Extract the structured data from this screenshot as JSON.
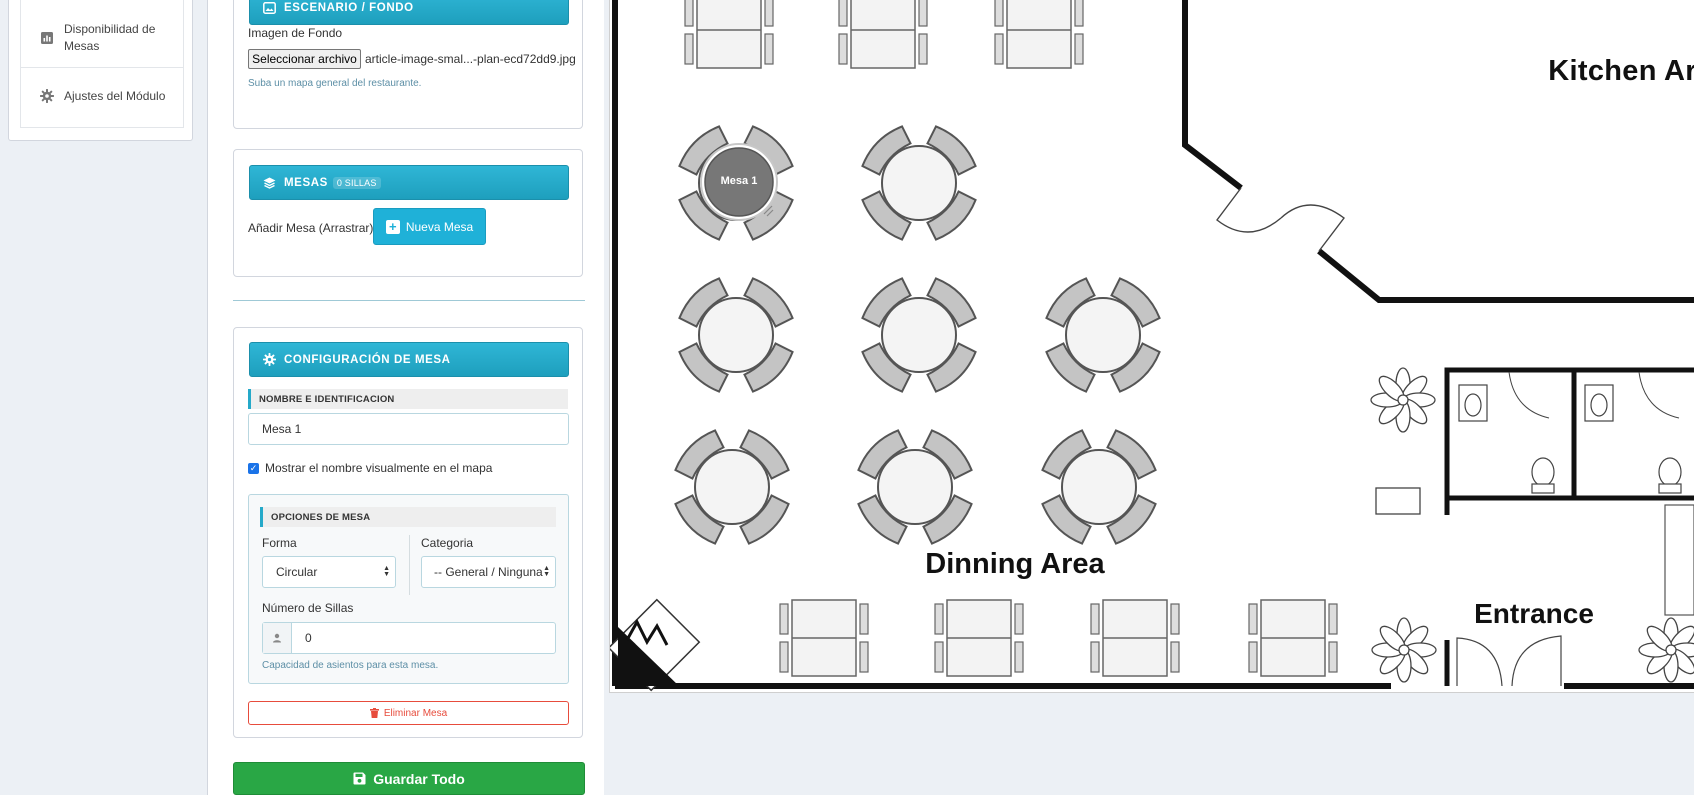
{
  "sidebar": {
    "items": [
      {
        "label": "Disponibilidad de Mesas",
        "icon": "bar-chart-icon"
      },
      {
        "label": "Ajustes del Módulo",
        "icon": "gear-icon"
      }
    ]
  },
  "background_section": {
    "title": "ESCENARIO / FONDO",
    "image_label": "Imagen de Fondo",
    "file_button": "Seleccionar archivo",
    "file_name": "article-image-smal...-plan-ecd72dd9.jpg",
    "help": "Suba un mapa general del restaurante."
  },
  "tables_section": {
    "title": "MESAS",
    "badge": "0 SILLAS",
    "add_label": "Añadir Mesa (Arrastrar)",
    "add_button": "Nueva Mesa"
  },
  "config_section": {
    "title": "CONFIGURACIÓN DE MESA",
    "name_heading": "NOMBRE E IDENTIFICACION",
    "name_value": "Mesa 1",
    "show_name_label": "Mostrar el nombre visualmente en el mapa",
    "show_name_checked": true,
    "options_heading": "OPCIONES DE MESA",
    "shape_label": "Forma",
    "shape_value": "Circular",
    "category_label": "Categoria",
    "category_value": "-- General / Ninguna --",
    "chairs_label": "Número de Sillas",
    "chairs_value": "0",
    "chairs_help": "Capacidad de asientos para esta mesa.",
    "delete_button": "Eliminar Mesa"
  },
  "save_button": "Guardar Todo",
  "map": {
    "labels": {
      "kitchen": "Kitchen Area",
      "dining": "Dinning Area",
      "entrance": "Entrance"
    },
    "table_marker": "Mesa 1"
  },
  "colors": {
    "accent": "#22a8cc",
    "save": "#29a745",
    "danger": "#e74c3c"
  }
}
